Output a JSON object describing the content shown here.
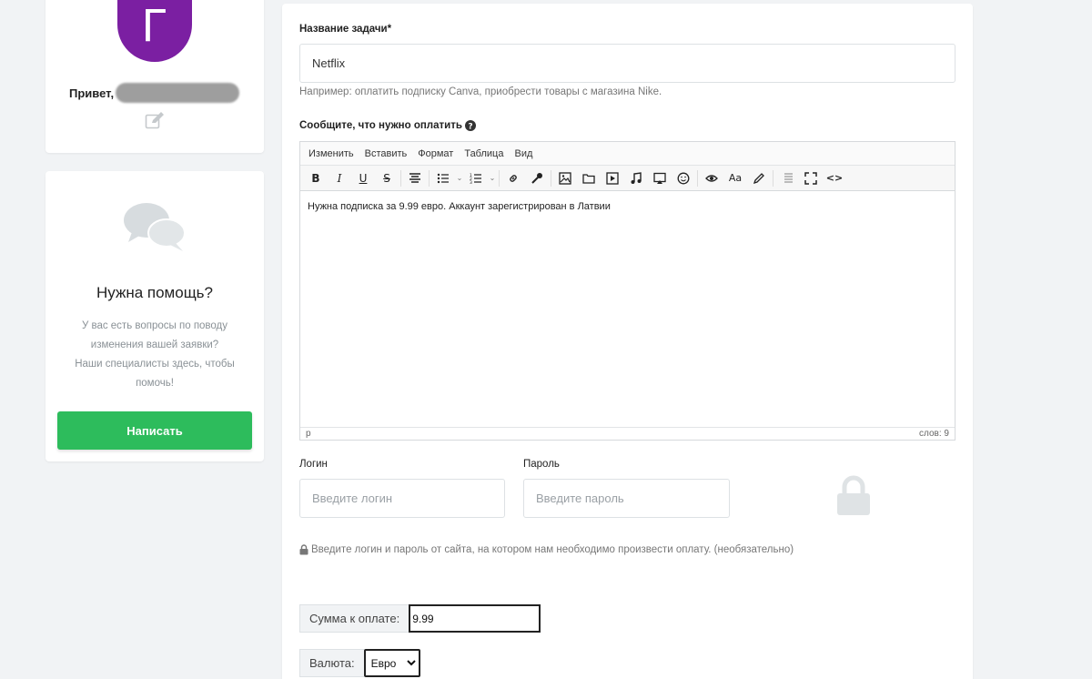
{
  "profile": {
    "avatar_letter": "Г",
    "greeting": "Привет,"
  },
  "help": {
    "title": "Нужна помощь?",
    "text_lines": [
      "У вас есть вопросы по поводу",
      "изменения вашей заявки?",
      "Наши специалисты здесь, чтобы",
      "помочь!"
    ],
    "button_label": "Написать"
  },
  "form": {
    "task_name_label": "Название задачи*",
    "task_name_value": "Netflix",
    "task_name_hint": "Например: оплатить подписку Canva, приобрести товары с магазина Nike.",
    "payment_label": "Сообщите, что нужно оплатить",
    "editor": {
      "menu": [
        "Изменить",
        "Вставить",
        "Формат",
        "Таблица",
        "Вид"
      ],
      "content": "Нужна подписка за 9.99 евро. Аккаунт зарегистрирован в Латвии",
      "status_path": "p",
      "word_count": "слов: 9"
    },
    "login_label": "Логин",
    "login_placeholder": "Введите логин",
    "password_label": "Пароль",
    "password_placeholder": "Введите пароль",
    "credentials_hint": "Введите логин и пароль от сайта, на котором нам необходимо произвести оплату. (необязательно)",
    "amount_label": "Сумма к оплате:",
    "amount_value": "9.99",
    "currency_label": "Валюта:",
    "currency_value": "Евро"
  },
  "colors": {
    "avatar": "#7b1fa2",
    "button": "#2dbc5c"
  }
}
